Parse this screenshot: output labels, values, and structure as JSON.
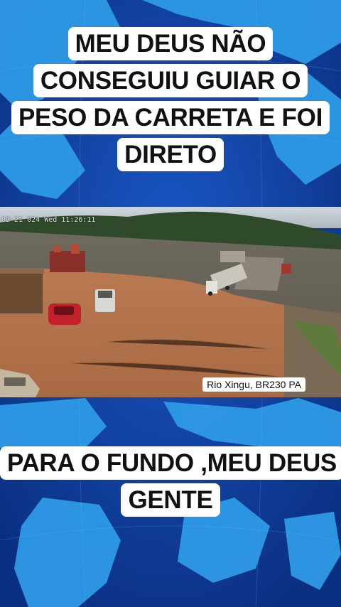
{
  "captions": {
    "top": "MEU DEUS NÃO CONSEGUIU GUIAR O PESO DA CARRETA E FOI DIRETO",
    "bottom": "PARA O FUNDO ,MEU DEUS GENTE"
  },
  "video": {
    "timestamp": "02-21 024 Wed 11:26:11",
    "location_label": "Rio Xingu, BR230 PA"
  },
  "colors": {
    "map_ocean": "#0d3f99",
    "map_land": "#2f9be8",
    "caption_bg": "#ffffff",
    "caption_text": "#111111"
  }
}
